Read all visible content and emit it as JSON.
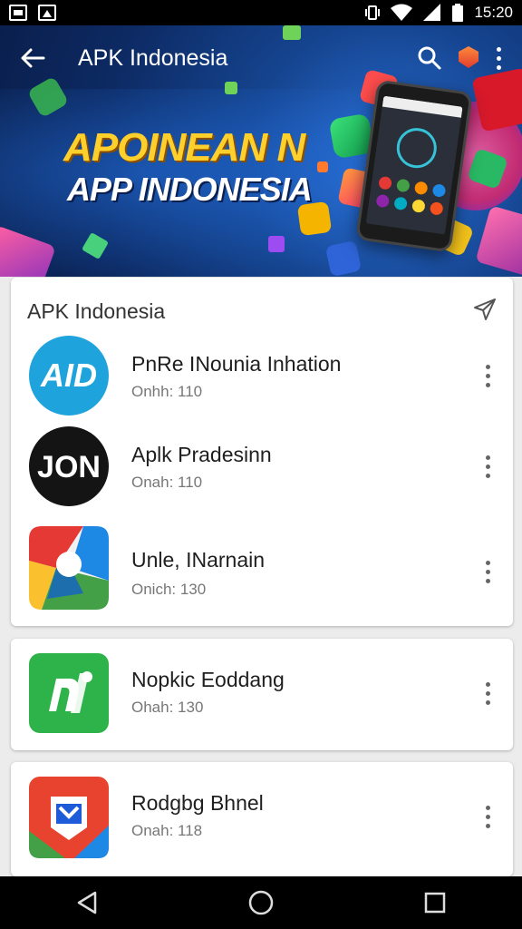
{
  "status_bar": {
    "time": "15:20",
    "left_icons": [
      "notification-icon",
      "gallery-icon"
    ],
    "right_icons": [
      "vibrate-icon",
      "wifi-icon",
      "signal-icon",
      "battery-icon"
    ]
  },
  "app_bar": {
    "title": "APK Indonesia",
    "icons": [
      "back-arrow-icon",
      "search-icon",
      "badge-icon",
      "overflow-menu-icon"
    ]
  },
  "banner": {
    "line1": "APOINEAN N",
    "line2": "APP INDONESIA"
  },
  "section": {
    "title": "APK Indonesia",
    "share_icon": "send-icon"
  },
  "apps": [
    {
      "name": "PnRe INounia Inhation",
      "sub": "Onhh: 110",
      "icon_text": "AID",
      "color": "#1fa3dc"
    },
    {
      "name": "Aplk Pradesinn",
      "sub": "Onah: 110",
      "icon_text": "JON",
      "color": "#141414"
    },
    {
      "name": "Unle, INarnain",
      "sub": "Onich: 130",
      "icon_text": "",
      "color": "#e53935"
    },
    {
      "name": "Nopkic Eoddang",
      "sub": "Ohah: 130",
      "icon_text": "",
      "color": "#2db34a"
    },
    {
      "name": "Rodgbg Bhnel",
      "sub": "Onah: 118",
      "icon_text": "",
      "color": "#e8432e"
    }
  ],
  "nav_bar": {
    "icons": [
      "back-triangle-icon",
      "home-circle-icon",
      "recents-square-icon"
    ]
  }
}
